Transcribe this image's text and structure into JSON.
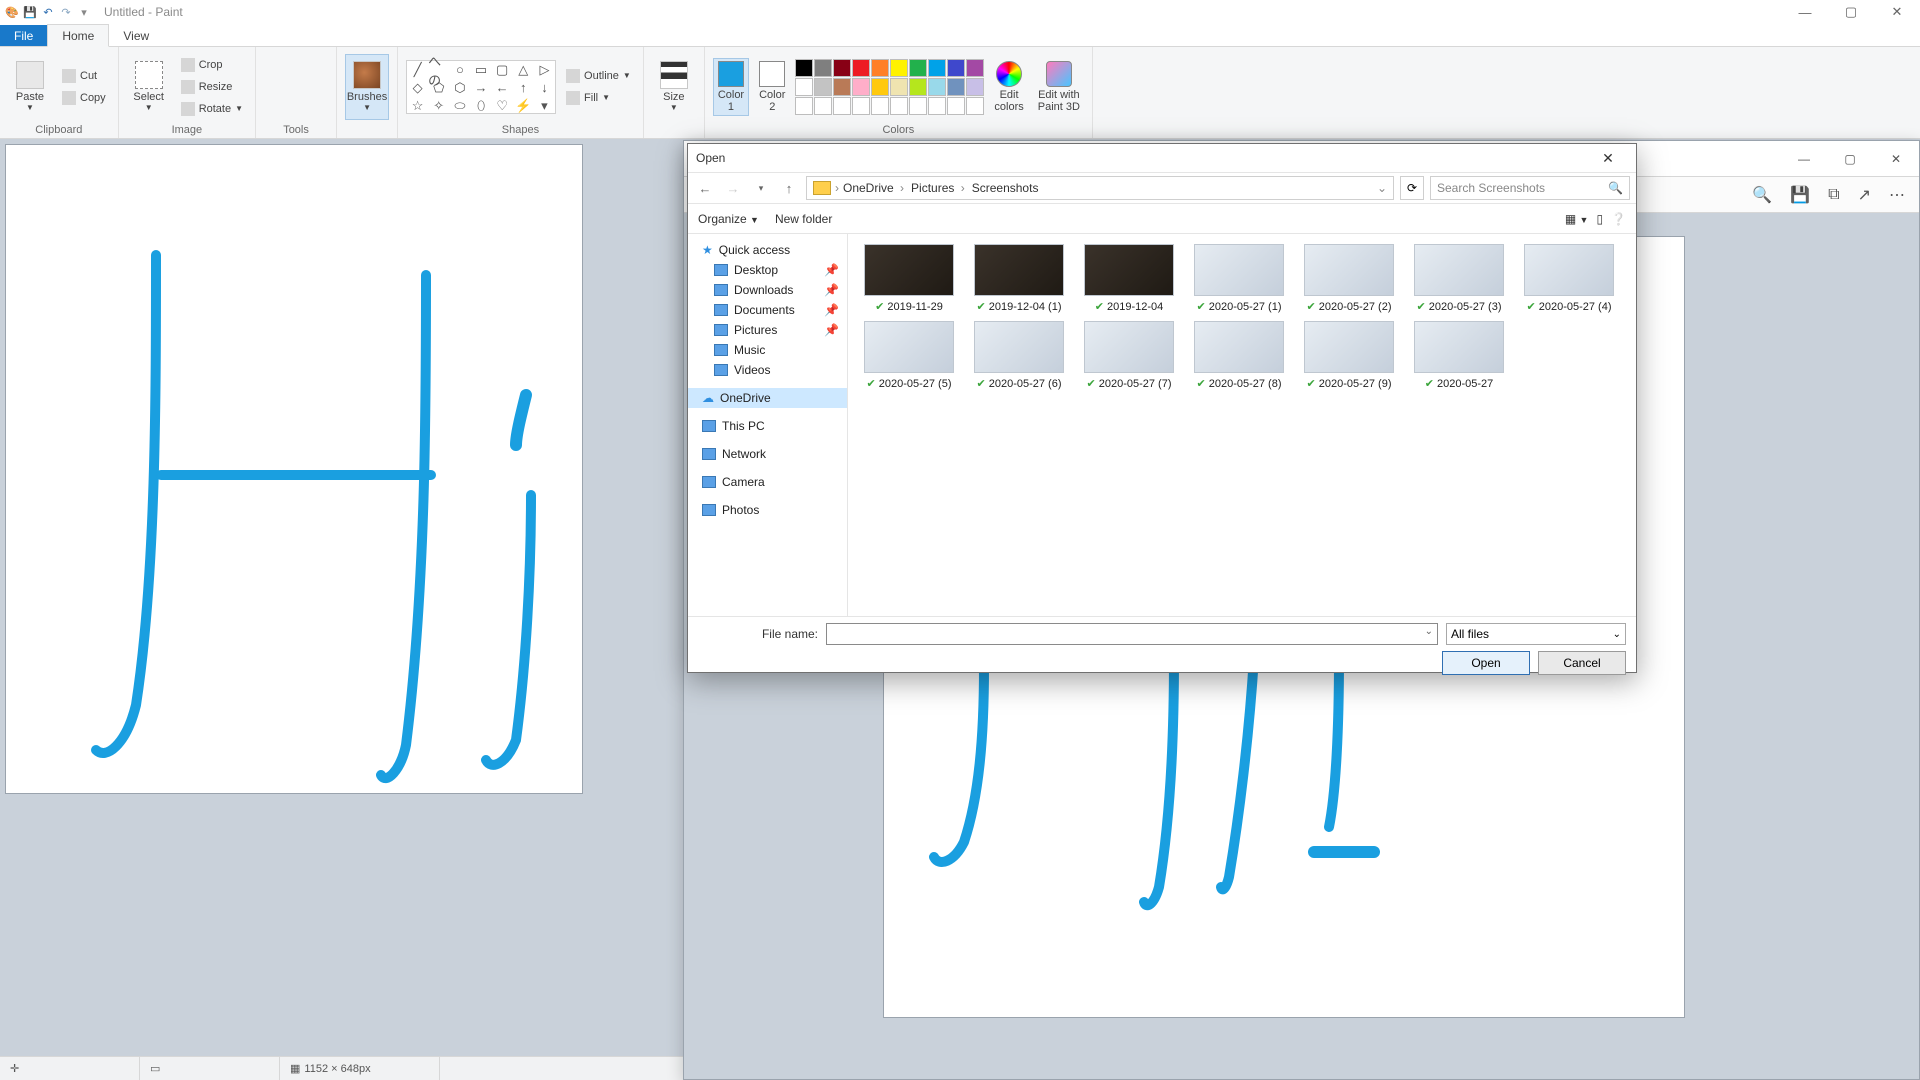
{
  "app": {
    "title": "Untitled - Paint"
  },
  "tabs": {
    "file": "File",
    "home": "Home",
    "view": "View"
  },
  "ribbon": {
    "clipboard": {
      "label": "Clipboard",
      "paste": "Paste",
      "cut": "Cut",
      "copy": "Copy"
    },
    "image": {
      "label": "Image",
      "select": "Select",
      "crop": "Crop",
      "resize": "Resize",
      "rotate": "Rotate"
    },
    "tools": {
      "label": "Tools"
    },
    "brushes": {
      "label": "Brushes"
    },
    "shapes": {
      "label": "Shapes",
      "outline": "Outline",
      "fill": "Fill"
    },
    "size": {
      "label": "Size"
    },
    "colors": {
      "label": "Colors",
      "c1a": "Color",
      "c1b": "1",
      "c2a": "Color",
      "c2b": "2",
      "edit_a": "Edit",
      "edit_b": "colors",
      "p3d_a": "Edit with",
      "p3d_b": "Paint 3D"
    }
  },
  "palette_colors": [
    "#000000",
    "#7f7f7f",
    "#880015",
    "#ed1c24",
    "#ff7f27",
    "#fff200",
    "#22b14c",
    "#00a2e8",
    "#3f48cc",
    "#a349a4",
    "#ffffff",
    "#c3c3c3",
    "#b97a57",
    "#ffaec9",
    "#ffc90e",
    "#efe4b0",
    "#b5e61d",
    "#99d9ea",
    "#7092be",
    "#c8bfe7",
    "#ffffff",
    "#ffffff",
    "#ffffff",
    "#ffffff",
    "#ffffff",
    "#ffffff",
    "#ffffff",
    "#ffffff",
    "#ffffff",
    "#ffffff"
  ],
  "status": {
    "dims": "1152 × 648px"
  },
  "dialog": {
    "title": "Open",
    "path": [
      "OneDrive",
      "Pictures",
      "Screenshots"
    ],
    "search_placeholder": "Search Screenshots",
    "organize": "Organize",
    "newfolder": "New folder",
    "tree": {
      "quick": "Quick access",
      "items": [
        "Desktop",
        "Downloads",
        "Documents",
        "Pictures",
        "Music",
        "Videos"
      ],
      "onedrive": "OneDrive",
      "thispc": "This PC",
      "network": "Network",
      "camera": "Camera",
      "photos": "Photos"
    },
    "files": [
      {
        "name": "2019-11-29",
        "dark": true
      },
      {
        "name": "2019-12-04 (1)",
        "dark": true
      },
      {
        "name": "2019-12-04",
        "dark": true
      },
      {
        "name": "2020-05-27 (1)",
        "dark": false
      },
      {
        "name": "2020-05-27 (2)",
        "dark": false
      },
      {
        "name": "2020-05-27 (3)",
        "dark": false
      },
      {
        "name": "2020-05-27 (4)",
        "dark": false
      },
      {
        "name": "2020-05-27 (5)",
        "dark": false
      },
      {
        "name": "2020-05-27 (6)",
        "dark": false
      },
      {
        "name": "2020-05-27 (7)",
        "dark": false
      },
      {
        "name": "2020-05-27 (8)",
        "dark": false
      },
      {
        "name": "2020-05-27 (9)",
        "dark": false
      },
      {
        "name": "2020-05-27",
        "dark": false
      }
    ],
    "filename_label": "File name:",
    "filetype": "All files",
    "open": "Open",
    "cancel": "Cancel"
  }
}
